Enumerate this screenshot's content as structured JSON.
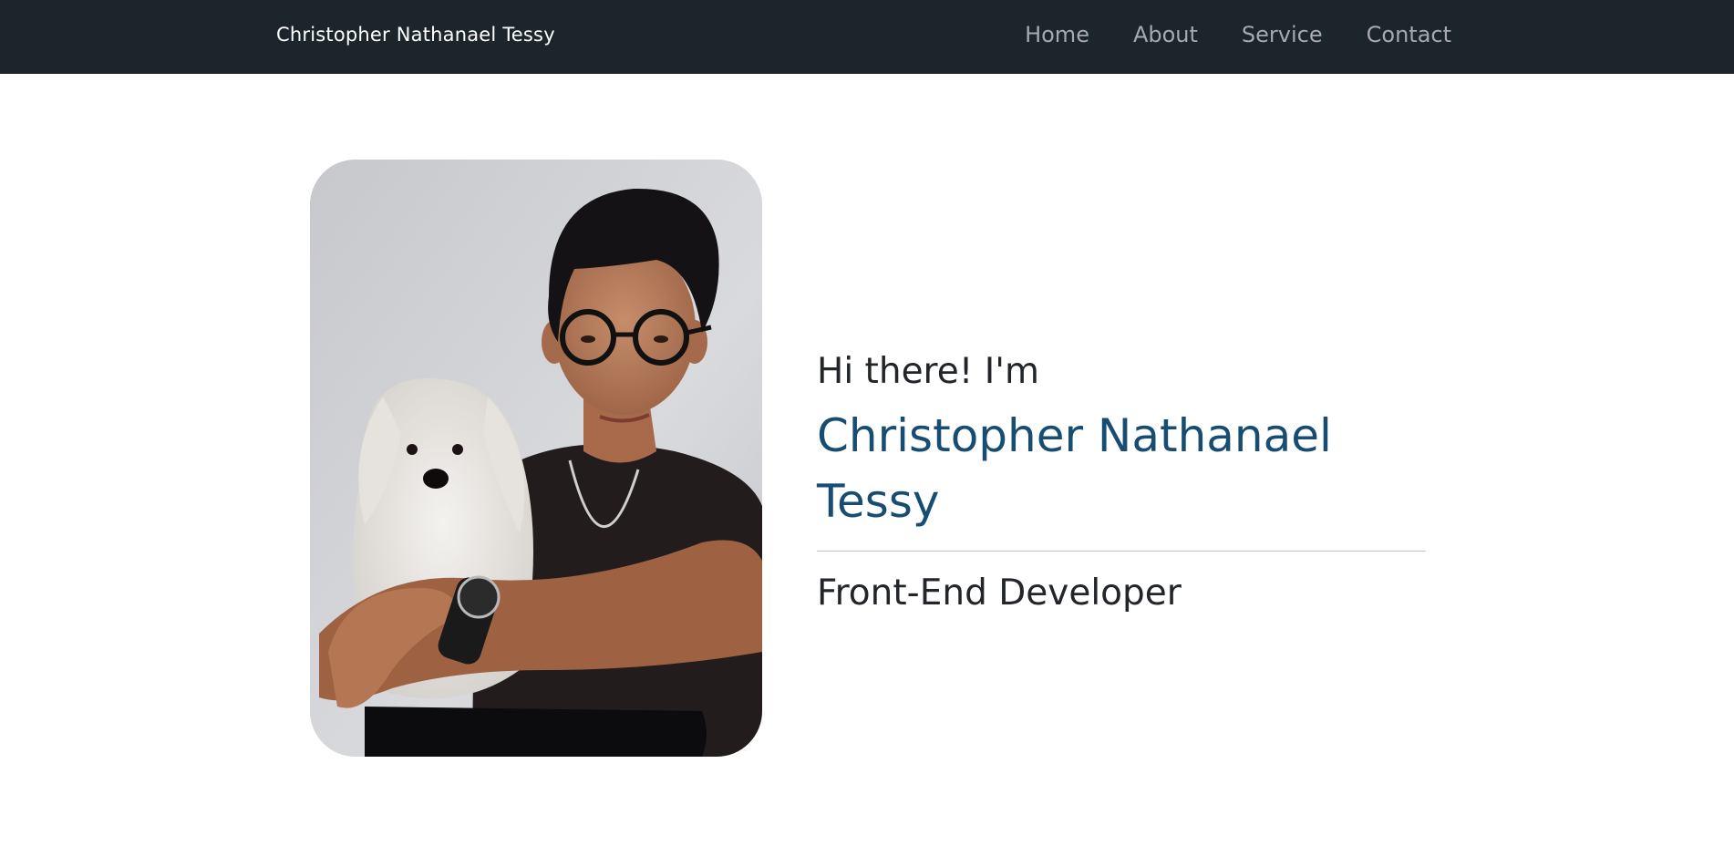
{
  "nav": {
    "brand": "Christopher Nathanael Tessy",
    "links": [
      {
        "label": "Home"
      },
      {
        "label": "About"
      },
      {
        "label": "Service"
      },
      {
        "label": "Contact"
      }
    ]
  },
  "hero": {
    "greeting": "Hi there! I'm",
    "name": "Christopher Nathanael Tessy",
    "role": "Front-End Developer",
    "photo_icon": "portrait-photo"
  },
  "colors": {
    "navbar_bg": "#1d252c",
    "nav_link": "#a6a9ad",
    "accent_name": "#174d72",
    "text_dark": "#22262a"
  }
}
